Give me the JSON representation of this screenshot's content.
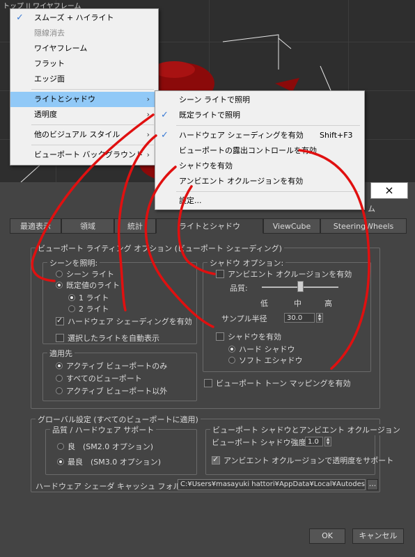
{
  "viewport": {
    "label": "トップ || ワイヤフレーム",
    "teapot_color": "#8b0a0a"
  },
  "view_menu": {
    "items": [
      {
        "label": "スムーズ + ハイライト",
        "checked": true
      },
      {
        "label": "隠線消去",
        "disabled": true
      },
      {
        "label": "ワイヤフレーム"
      },
      {
        "label": "フラット"
      },
      {
        "label": "エッジ面"
      },
      {
        "label": "ライトとシャドウ",
        "submenu": true,
        "highlighted": true
      },
      {
        "label": "透明度",
        "submenu": true
      },
      {
        "label": "他のビジュアル スタイル",
        "submenu": true
      },
      {
        "label": "ビューポート バックグラウンド",
        "submenu": true
      }
    ]
  },
  "lights_submenu": {
    "items": [
      {
        "label": "シーン ライトで照明"
      },
      {
        "label": "既定ライトで照明",
        "checked": true
      },
      {
        "label": "ハードウェア シェーディングを有効",
        "checked": true,
        "shortcut": "Shift+F3"
      },
      {
        "label": "ビューポートの露出コントロールを有効"
      },
      {
        "label": "シャドウを有効"
      },
      {
        "label": "アンビエント オクルージョンを有効"
      },
      {
        "label": "設定..."
      }
    ]
  },
  "dialog": {
    "close_icon": "×",
    "partial_title": "ム",
    "tabs": [
      "最適表示",
      "領域",
      "統計",
      "ライトとシャドウ",
      "ViewCube",
      "SteeringWheels"
    ],
    "active_tab": "ライトとシャドウ",
    "section_title": "ビューポート ライティング オプション (ビューポート シェーディング)",
    "scene_lighting": {
      "title": "シーンを照明:",
      "scene_lights": "シーン ライト",
      "default_lights": "既定値のライト",
      "one_light": "1 ライト",
      "two_lights": "2 ライト",
      "hw_shading": "ハードウェア シェーディングを有効",
      "auto_display": "選択したライトを自動表示"
    },
    "apply_to": {
      "title": "適用先",
      "active_only": "アクティブ ビューポートのみ",
      "all": "すべてのビューポート",
      "except_active": "アクティブ ビューポート以外"
    },
    "shadow_options": {
      "title": "シャドウ オプション:",
      "ao_enable": "アンビエント オクルージョンを有効",
      "quality_label": "品質:",
      "quality_low": "低",
      "quality_mid": "中",
      "quality_high": "高",
      "quality_level": 0.5,
      "sample_radius_label": "サンプル半径",
      "sample_radius_value": "30.0",
      "shadow_enable": "シャドウを有効",
      "hard_shadow": "ハード シャドウ",
      "soft_shadow": "ソフト エシャドウ"
    },
    "tone_mapping": "ビューポート トーン マッピングを有効",
    "global": {
      "title": "グローバル設定 (すべてのビューポートに適用)",
      "quality_title": "品質 / ハードウェア サポート",
      "good": "良　(SM2.0 オプション)",
      "best": "最良　(SM3.0 オプション)",
      "shadow_ao_title": "ビューポート シャドウとアンビエント オクルージョン",
      "shadow_intensity_label": "ビューポート シャドウ強度",
      "shadow_intensity_value": "1.0",
      "ao_transparency": "アンビエント オクルージョンで透明度をサポート",
      "cache_folder_label": "ハードウェア シェーダ キャッシュ フォルダ:",
      "cache_folder_path": "C:¥Users¥masayuki hattori¥AppData¥Local¥Autodes",
      "browse_label": "..."
    },
    "ok_label": "OK",
    "cancel_label": "キャンセル"
  },
  "annotation_color": "#e01010"
}
